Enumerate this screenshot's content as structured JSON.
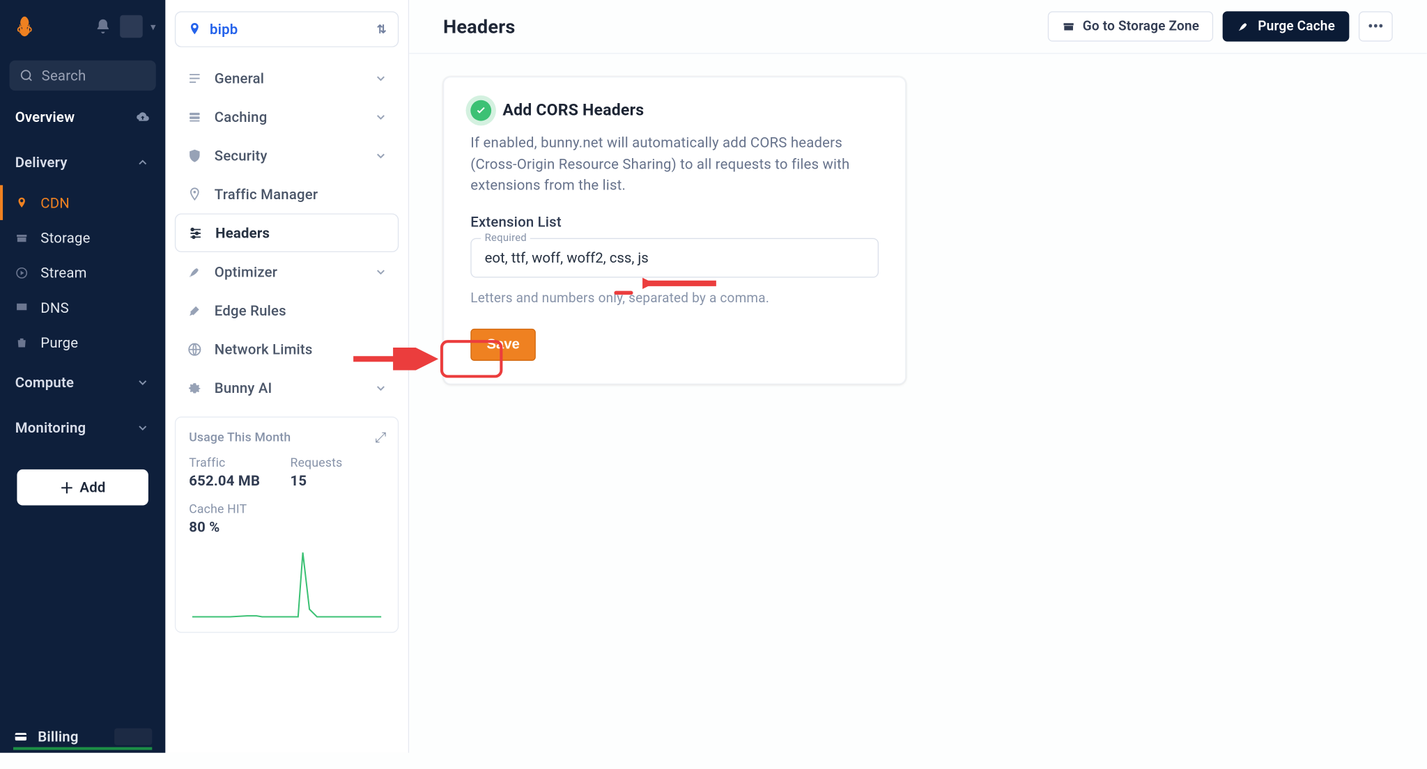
{
  "leftnav": {
    "search_placeholder": "Search",
    "sections": {
      "overview_label": "Overview",
      "delivery_label": "Delivery",
      "compute_label": "Compute",
      "monitoring_label": "Monitoring"
    },
    "delivery_items": [
      {
        "label": "CDN",
        "icon": "pin"
      },
      {
        "label": "Storage",
        "icon": "box"
      },
      {
        "label": "Stream",
        "icon": "play"
      },
      {
        "label": "DNS",
        "icon": "monitor"
      },
      {
        "label": "Purge",
        "icon": "trash"
      }
    ],
    "add_label": "Add",
    "billing_label": "Billing"
  },
  "pullzone": {
    "selected": "bipb",
    "items": [
      {
        "label": "General",
        "expandable": true
      },
      {
        "label": "Caching",
        "expandable": true
      },
      {
        "label": "Security",
        "expandable": true
      },
      {
        "label": "Traffic Manager",
        "expandable": false
      },
      {
        "label": "Headers",
        "expandable": false,
        "active": true
      },
      {
        "label": "Optimizer",
        "expandable": true
      },
      {
        "label": "Edge Rules",
        "expandable": false
      },
      {
        "label": "Network Limits",
        "expandable": false
      },
      {
        "label": "Bunny AI",
        "expandable": true
      }
    ],
    "usage": {
      "head_label": "Usage This Month",
      "traffic_label": "Traffic",
      "traffic_value": "652.04 MB",
      "requests_label": "Requests",
      "requests_value": "15",
      "cache_label": "Cache HIT",
      "cache_value": "80 %"
    }
  },
  "main": {
    "page_title": "Headers",
    "storage_btn_label": "Go to Storage Zone",
    "purge_btn_label": "Purge Cache",
    "card": {
      "title": "Add CORS Headers",
      "description": "If enabled, bunny.net will automatically add CORS headers (Cross-Origin Resource Sharing) to all requests to files with extensions from the list.",
      "field_label": "Extension List",
      "float_label": "Required",
      "input_value": "eot, ttf, woff, woff2, css, js",
      "helper_text": "Letters and numbers only, separated by a comma.",
      "save_label": "Save"
    }
  },
  "chart_data": {
    "type": "line",
    "title": "Usage This Month (sparkline)",
    "xlabel": "",
    "ylabel": "",
    "x": [
      0,
      1,
      2,
      3,
      4,
      5,
      6,
      7,
      8,
      9,
      10,
      11,
      12,
      13,
      14,
      15,
      16,
      17,
      18,
      19
    ],
    "values": [
      0,
      0,
      0,
      0,
      0,
      0,
      0.02,
      0.02,
      0,
      0,
      0,
      0.98,
      0.1,
      0,
      0,
      0,
      0,
      0,
      0,
      0
    ],
    "ylim": [
      0,
      1
    ]
  }
}
